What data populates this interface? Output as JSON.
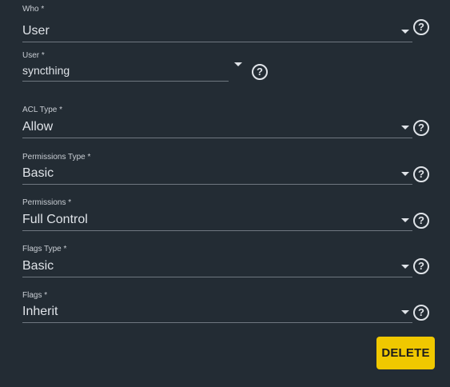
{
  "form": {
    "who": {
      "label": "Who *",
      "value": "User"
    },
    "user": {
      "label": "User *",
      "value": "syncthing"
    },
    "acl_type": {
      "label": "ACL Type *",
      "value": "Allow"
    },
    "permissions_type": {
      "label": "Permissions Type *",
      "value": "Basic"
    },
    "permissions": {
      "label": "Permissions *",
      "value": "Full Control"
    },
    "flags_type": {
      "label": "Flags Type *",
      "value": "Basic"
    },
    "flags": {
      "label": "Flags *",
      "value": "Inherit"
    },
    "help_glyph": "?"
  },
  "actions": {
    "delete_label": "DELETE"
  },
  "colors": {
    "background": "#232c34",
    "text": "#dfe3e8",
    "underline": "#6f7780",
    "delete_button": "#f0c800"
  },
  "icons": {
    "dropdown": "chevron-down-icon",
    "help": "help-circle-icon"
  }
}
